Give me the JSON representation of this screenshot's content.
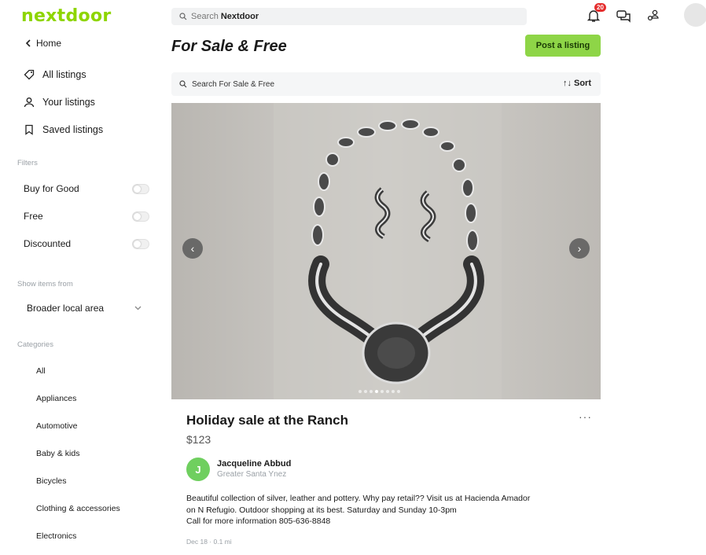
{
  "header": {
    "logo": "nextdoor",
    "search_prefix": "Search",
    "search_brand": "Nextdoor",
    "notification_count": "20"
  },
  "sidebar": {
    "back_label": "Home",
    "nav": [
      {
        "label": "All listings",
        "icon": "tag-icon"
      },
      {
        "label": "Your listings",
        "icon": "person-icon"
      },
      {
        "label": "Saved listings",
        "icon": "bookmark-icon"
      }
    ],
    "filters_heading": "Filters",
    "filters": [
      {
        "label": "Buy for Good",
        "on": false
      },
      {
        "label": "Free",
        "on": false
      },
      {
        "label": "Discounted",
        "on": false
      }
    ],
    "show_items_heading": "Show items from",
    "area_value": "Broader local area",
    "categories_heading": "Categories",
    "categories": [
      "All",
      "Appliances",
      "Automotive",
      "Baby & kids",
      "Bicycles",
      "Clothing & accessories",
      "Electronics"
    ]
  },
  "main": {
    "title": "For Sale & Free",
    "post_button": "Post a listing",
    "search_placeholder": "Search For Sale & Free",
    "sort_label": "Sort"
  },
  "listing": {
    "title": "Holiday sale at the Ranch",
    "price": "$123",
    "seller_initial": "J",
    "seller_name": "Jacqueline Abbud",
    "seller_area": "Greater Santa Ynez",
    "description_lines": [
      "Beautiful collection of silver, leather and pottery. Why pay retail??  Visit us at Hacienda Amador",
      "on N Refugio. Outdoor shopping at its best. Saturday and Sunday 10-3pm",
      "Call for more information 805-636-8848"
    ],
    "meta": "Dec 18 · 0.1 mi",
    "photo_count": 8,
    "active_photo": 3
  },
  "colors": {
    "brand_green": "#8ed500",
    "button_green": "#8ed547",
    "badge_red": "#e52d2d"
  }
}
